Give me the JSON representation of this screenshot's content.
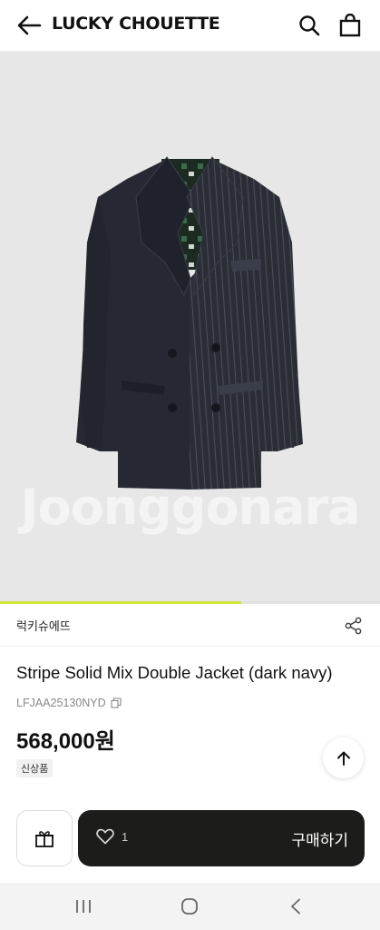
{
  "header": {
    "brand": "LUCKY CHOUETTE",
    "icons": [
      "back-arrow-icon",
      "search-icon",
      "shopping-bag-icon"
    ]
  },
  "hero": {
    "watermark": "Joonggonara",
    "image_progress": 0.635,
    "colors": {
      "background": "#e7e7e7",
      "jacket": "#2a2d36",
      "progress": "#cfe63a"
    }
  },
  "product": {
    "brand_name": "럭키슈에뜨",
    "title": "Stripe Solid Mix Double Jacket (dark navy)",
    "sku": "LFJAA25130NYD",
    "price": "568,000원",
    "tag": "신상품"
  },
  "actions": {
    "like_count": "1",
    "buy_label": "구매하기",
    "icons": [
      "gift-icon",
      "heart-icon",
      "share-icon",
      "arrow-up-icon",
      "copy-icon"
    ]
  },
  "system_nav": {
    "icons": [
      "recent-apps-icon",
      "home-icon",
      "back-icon"
    ]
  }
}
